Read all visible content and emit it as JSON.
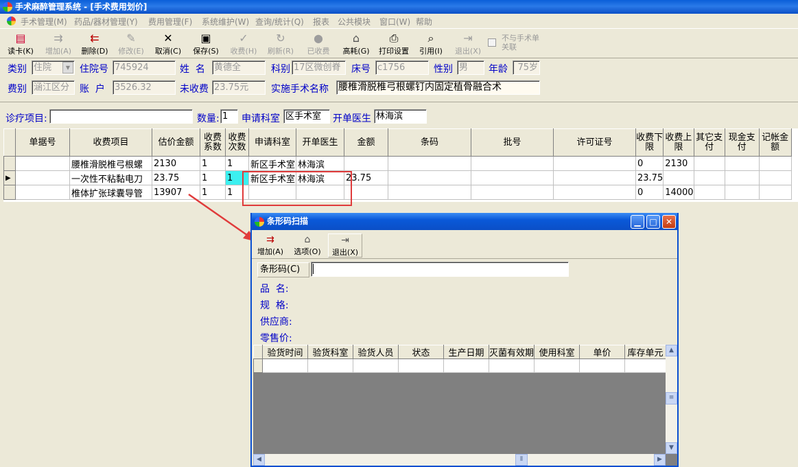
{
  "titlebar": {
    "title": "手术麻醉管理系统 - [手术费用划价]"
  },
  "menu": [
    "手术管理(M)",
    "药品/器材管理(Y)",
    "费用管理(F)",
    "系统维护(W)",
    "查询/统计(Q)",
    "报表",
    "公共模块",
    "窗口(W)",
    "帮助"
  ],
  "toolbar": {
    "read_card": "读卡(K)",
    "add": "增加(A)",
    "delete": "删除(D)",
    "modify": "修改(E)",
    "cancel": "取消(C)",
    "save": "保存(S)",
    "charge": "收费(H)",
    "refresh": "刷新(R)",
    "charged": "已收费",
    "high_value": "高耗(G)",
    "print_setup": "打印设置",
    "quote": "引用(I)",
    "exit": "退出(X)",
    "unlink": "不与手术单关联"
  },
  "patient": {
    "category_label": "类别",
    "category": "住院",
    "inpatient_no_label": "住院号",
    "inpatient_no": "745924",
    "name_label": "姓  名",
    "name": "黄德全",
    "dept_label": "科别",
    "dept": "17区微创脊",
    "bed_label": "床号",
    "bed": "c1756",
    "gender_label": "性别",
    "gender": "男",
    "age_label": "年龄",
    "age": "75岁",
    "fee_type_label": "费别",
    "fee_type": "涵江区分",
    "account_label": "账  户",
    "account": "3526.32",
    "uncharged_label": "未收费",
    "uncharged": "23.75元",
    "surgery_label": "实施手术名称",
    "surgery": "腰椎滑脱椎弓根螺钉内固定植骨融合术"
  },
  "entry": {
    "item_label": "诊疗项目:",
    "item": "",
    "qty_label": "数量:",
    "qty": "1",
    "apply_dept_label": "申请科室",
    "apply_dept": "区手术室",
    "doctor_label": "开单医生",
    "doctor": "林海滨"
  },
  "grid": {
    "headers": [
      "单据号",
      "收费项目",
      "估价金额",
      "收费系数",
      "收费次数",
      "申请科室",
      "开单医生",
      "金额",
      "条码",
      "批号",
      "许可证号",
      "收费下限",
      "收费上限",
      "其它支付",
      "现金支付",
      "记帐金额"
    ],
    "rows": [
      [
        "",
        "腰椎滑脱椎弓根螺",
        "2130",
        "1",
        "1",
        "新区手术室",
        "林海滨",
        "",
        "",
        "",
        "",
        "0",
        "2130",
        "",
        "",
        ""
      ],
      [
        "",
        "一次性不粘黏电刀",
        "23.75",
        "1",
        "1",
        "新区手术室",
        "林海滨",
        "23.75",
        "",
        "",
        "",
        "23.75",
        "",
        "",
        "",
        ""
      ],
      [
        "",
        "椎体扩张球囊导管",
        "13907",
        "1",
        "1",
        "",
        "",
        "",
        "",
        "",
        "",
        "0",
        "14000",
        "",
        "",
        ""
      ]
    ]
  },
  "dialog": {
    "title": "条形码扫描",
    "add": "增加(A)",
    "options": "选项(O)",
    "exit": "退出(X)",
    "barcode_label": "条形码(C)",
    "barcode": "",
    "product_label": "品  名:",
    "spec_label": "规  格:",
    "supplier_label": "供应商:",
    "retail_label": "零售价:",
    "headers": [
      "验货时间",
      "验货科室",
      "验货人员",
      "状态",
      "生产日期",
      "灭菌有效期",
      "使用科室",
      "单价",
      "库存单元"
    ]
  },
  "colors": {
    "title_blue": "#0a59d9",
    "label_blue": "#0000c8",
    "highlight": "#3cf0f0",
    "annotation_red": "#e03b3b"
  }
}
